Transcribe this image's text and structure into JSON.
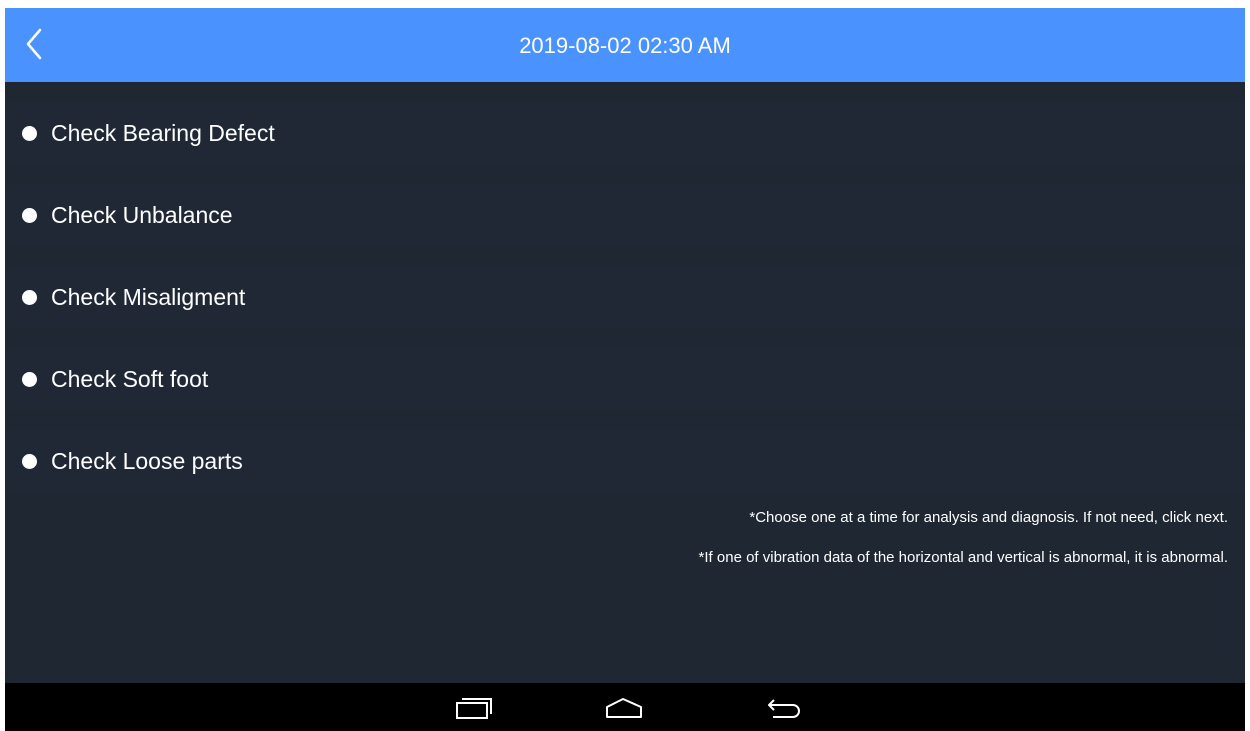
{
  "header": {
    "title": "2019-08-02 02:30 AM",
    "back_icon": "chevron-left-icon"
  },
  "checks": [
    {
      "label": "Check Bearing Defect"
    },
    {
      "label": "Check Unbalance"
    },
    {
      "label": "Check Misaligment"
    },
    {
      "label": "Check Soft foot"
    },
    {
      "label": "Check Loose parts"
    }
  ],
  "notes": {
    "note1": "*Choose one at a time for analysis and diagnosis. If not need, click next.",
    "note2": "*If one of vibration data of the horizontal and vertical is abnormal, it is abnormal."
  },
  "navbar": {
    "recents_icon": "recents-icon",
    "home_icon": "home-icon",
    "back_icon": "back-arrow-icon"
  },
  "colors": {
    "header": "#4a93ff",
    "background": "#1f2733",
    "text": "#ffffff",
    "navbar": "#000000"
  }
}
